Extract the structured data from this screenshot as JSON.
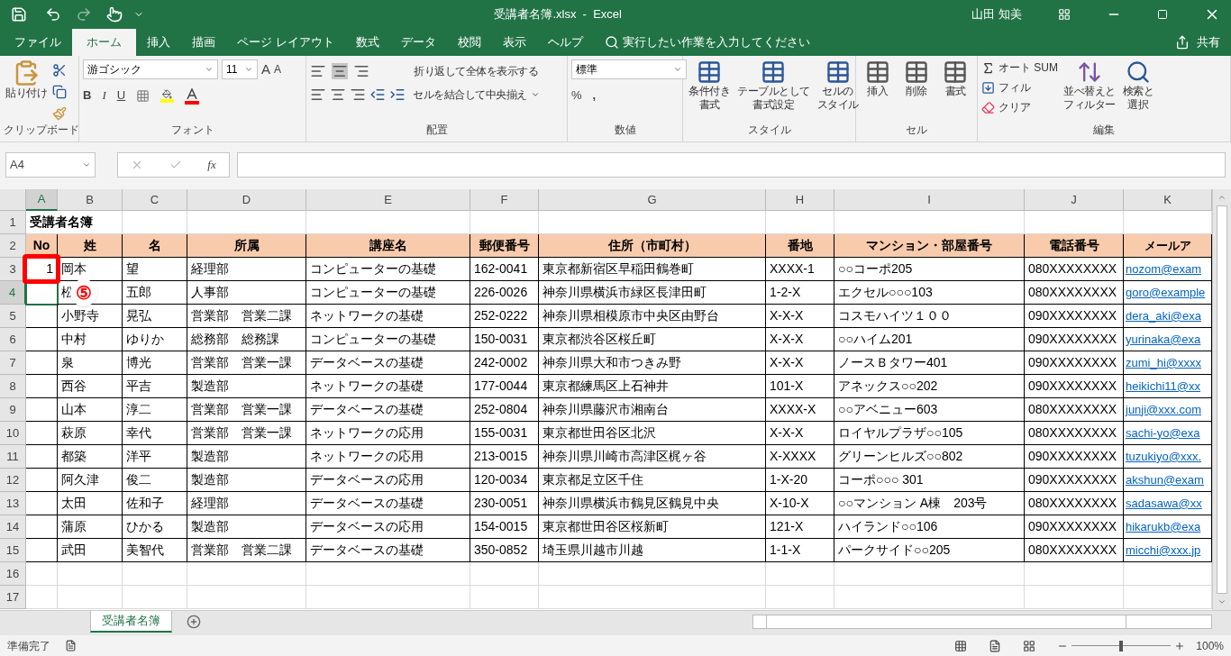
{
  "title_bar": {
    "title": "受講者名簿.xlsx  -  Excel",
    "user": "山田 知美"
  },
  "menu_tabs": [
    {
      "label": "ファイル",
      "selected": false
    },
    {
      "label": "ホーム",
      "selected": true
    },
    {
      "label": "挿入",
      "selected": false
    },
    {
      "label": "描画",
      "selected": false
    },
    {
      "label": "ページ レイアウト",
      "selected": false
    },
    {
      "label": "数式",
      "selected": false
    },
    {
      "label": "データ",
      "selected": false
    },
    {
      "label": "校閲",
      "selected": false
    },
    {
      "label": "表示",
      "selected": false
    },
    {
      "label": "ヘルプ",
      "selected": false
    }
  ],
  "tell_me": "実行したい作業を入力してください",
  "share": "共有",
  "ribbon": {
    "clipboard": {
      "paste": "貼り付け",
      "label": "クリップボード"
    },
    "font": {
      "name": "游ゴシック",
      "size": "11",
      "grow": "A",
      "shrink": "A",
      "bold": "B",
      "italic": "I",
      "underline": "U",
      "label": "フォント"
    },
    "alignment": {
      "wrap": "折り返して全体を表示する",
      "merge": "セルを結合して中央揃え",
      "label": "配置"
    },
    "number": {
      "format": "標準",
      "percent": "%",
      "comma": ",",
      "label": "数値"
    },
    "styles": {
      "buttons": [
        [
          "条件付き",
          "書式"
        ],
        [
          "テーブルとして",
          "書式設定"
        ],
        [
          "セルの",
          "スタイル"
        ]
      ],
      "label": "スタイル"
    },
    "cells": {
      "buttons": [
        "挿入",
        "削除",
        "書式"
      ],
      "label": "セル"
    },
    "editing": {
      "autosum": "オート SUM",
      "fill": "フィル",
      "clear": "クリア",
      "sort": [
        "並べ替えと",
        "フィルター"
      ],
      "find": [
        "検索と",
        "選択"
      ],
      "label": "編集"
    }
  },
  "formula_bar": {
    "name_box": "A4",
    "fx": "fx"
  },
  "columns": [
    {
      "letter": "A",
      "selected": true
    },
    {
      "letter": "B",
      "selected": false
    },
    {
      "letter": "C",
      "selected": false
    },
    {
      "letter": "D",
      "selected": false
    },
    {
      "letter": "E",
      "selected": false
    },
    {
      "letter": "F",
      "selected": false
    },
    {
      "letter": "G",
      "selected": false
    },
    {
      "letter": "H",
      "selected": false
    },
    {
      "letter": "I",
      "selected": false
    },
    {
      "letter": "J",
      "selected": false
    },
    {
      "letter": "K",
      "selected": false
    }
  ],
  "rows": [
    {
      "number": "1",
      "kind": "title",
      "selected": false,
      "cells": [
        "受講者名簿"
      ]
    },
    {
      "number": "2",
      "kind": "header",
      "selected": false,
      "cells": [
        "No",
        "姓",
        "名",
        "所属",
        "講座名",
        "郵便番号",
        "住所（市町村）",
        "番地",
        "マンション・部屋番号",
        "電話番号",
        "メールア"
      ]
    },
    {
      "number": "3",
      "kind": "data",
      "selected": false,
      "marked": true,
      "cells": [
        "1",
        "岡本",
        "望",
        "経理部",
        "コンピューターの基礎",
        "162-0041",
        "東京都新宿区早稲田鶴巻町",
        "XXXX-1",
        "○○コーポ205",
        "080XXXXXXXX",
        "nozom@exam"
      ]
    },
    {
      "number": "4",
      "kind": "data",
      "selected": true,
      "callout": "⑤",
      "cells": [
        "",
        "松",
        "五郎",
        "人事部",
        "コンピューターの基礎",
        "226-0026",
        "神奈川県横浜市緑区長津田町",
        "1-2-X",
        "エクセル○○○103",
        "080XXXXXXXX",
        "goro@example"
      ]
    },
    {
      "number": "5",
      "kind": "data",
      "selected": false,
      "cells": [
        "",
        "小野寺",
        "晃弘",
        "営業部　営業二課",
        "ネットワークの基礎",
        "252-0222",
        "神奈川県相模原市中央区由野台",
        "X-X-X",
        "コスモハイツ１００",
        "090XXXXXXXX",
        "dera_aki@exa"
      ]
    },
    {
      "number": "6",
      "kind": "data",
      "selected": false,
      "cells": [
        "",
        "中村",
        "ゆりか",
        "総務部　総務課",
        "コンピューターの基礎",
        "150-0031",
        "東京都渋谷区桜丘町",
        "X-X-X",
        "○○ハイム201",
        "090XXXXXXXX",
        "yurinaka@exa"
      ]
    },
    {
      "number": "7",
      "kind": "data",
      "selected": false,
      "cells": [
        "",
        "泉",
        "博光",
        "営業部　営業一課",
        "データベースの基礎",
        "242-0002",
        "神奈川県大和市つきみ野",
        "X-X-X",
        "ノースＢタワー401",
        "090XXXXXXXX",
        "zumi_hi@xxxx"
      ]
    },
    {
      "number": "8",
      "kind": "data",
      "selected": false,
      "cells": [
        "",
        "西谷",
        "平吉",
        "製造部",
        "ネットワークの基礎",
        "177-0044",
        "東京都練馬区上石神井",
        "101-X",
        "アネックス○○202",
        "090XXXXXXXX",
        "heikichi11@xx"
      ]
    },
    {
      "number": "9",
      "kind": "data",
      "selected": false,
      "cells": [
        "",
        "山本",
        "淳二",
        "営業部　営業一課",
        "データベースの基礎",
        "252-0804",
        "神奈川県藤沢市湘南台",
        "XXXX-X",
        "○○アベニュー603",
        "080XXXXXXXX",
        "junji@xxx.com"
      ]
    },
    {
      "number": "10",
      "kind": "data",
      "selected": false,
      "cells": [
        "",
        "萩原",
        "幸代",
        "営業部　営業一課",
        "ネットワークの応用",
        "155-0031",
        "東京都世田谷区北沢",
        "X-X-X",
        "ロイヤルプラザ○○105",
        "080XXXXXXXX",
        "sachi-yo@exa"
      ]
    },
    {
      "number": "11",
      "kind": "data",
      "selected": false,
      "cells": [
        "",
        "都築",
        "洋平",
        "製造部",
        "ネットワークの応用",
        "213-0015",
        "神奈川県川崎市高津区梶ヶ谷",
        "X-XXXX",
        "グリーンヒルズ○○802",
        "090XXXXXXXX",
        "tuzukiyo@xxx."
      ]
    },
    {
      "number": "12",
      "kind": "data",
      "selected": false,
      "cells": [
        "",
        "阿久津",
        "俊二",
        "製造部",
        "データベースの応用",
        "120-0034",
        "東京都足立区千住",
        "1-X-20",
        "コーポ○○○ 301",
        "090XXXXXXXX",
        "akshun@exam"
      ]
    },
    {
      "number": "13",
      "kind": "data",
      "selected": false,
      "cells": [
        "",
        "太田",
        "佐和子",
        "経理部",
        "データベースの基礎",
        "230-0051",
        "神奈川県横浜市鶴見区鶴見中央",
        "X-10-X",
        "○○マンション A棟　203号",
        "080XXXXXXXX",
        "sadasawa@xx"
      ]
    },
    {
      "number": "14",
      "kind": "data",
      "selected": false,
      "cells": [
        "",
        "蒲原",
        "ひかる",
        "製造部",
        "データベースの応用",
        "154-0015",
        "東京都世田谷区桜新町",
        "121-X",
        "ハイランド○○106",
        "090XXXXXXXX",
        "hikarukb@exa"
      ]
    },
    {
      "number": "15",
      "kind": "data",
      "selected": false,
      "cells": [
        "",
        "武田",
        "美智代",
        "営業部　営業二課",
        "データベースの基礎",
        "350-0852",
        "埼玉県川越市川越",
        "1-1-X",
        "パークサイド○○205",
        "080XXXXXXXX",
        "micchi@xxx.jp"
      ]
    },
    {
      "number": "16",
      "kind": "empty",
      "selected": false,
      "cells": []
    },
    {
      "number": "17",
      "kind": "empty",
      "selected": false,
      "cells": []
    }
  ],
  "sheet_tabs": [
    {
      "label": "受講者名簿",
      "selected": true
    }
  ],
  "status_bar": {
    "status": "準備完了",
    "zoom": {
      "level": 0.5,
      "reading": "100%"
    }
  }
}
